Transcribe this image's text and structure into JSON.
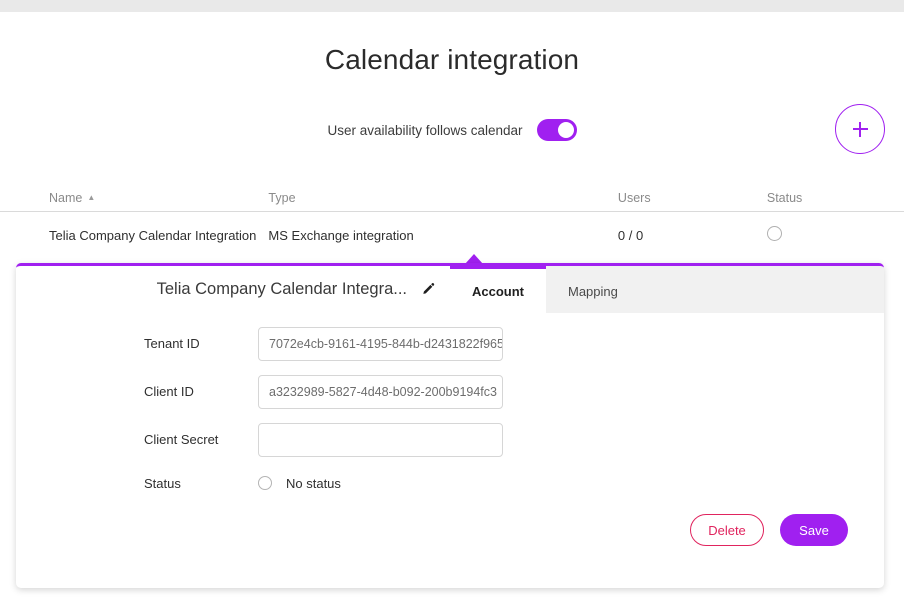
{
  "page": {
    "title": "Calendar integration"
  },
  "toggle": {
    "label": "User availability follows calendar",
    "state": "on"
  },
  "add_button": {
    "icon": "plus-icon",
    "label": "+"
  },
  "table": {
    "columns": [
      {
        "key": "name",
        "label": "Name",
        "sorted": "asc",
        "sort_caret": "▲"
      },
      {
        "key": "type",
        "label": "Type"
      },
      {
        "key": "users",
        "label": "Users"
      },
      {
        "key": "status",
        "label": "Status"
      }
    ],
    "rows": [
      {
        "name": "Telia Company Calendar Integration",
        "type": "MS Exchange integration",
        "users": "0 / 0",
        "status": "empty-circle"
      }
    ]
  },
  "panel": {
    "title": "Telia Company Calendar Integra...",
    "edit_icon": "pencil-icon",
    "accent_color": "#A020F0",
    "tabs": [
      {
        "label": "Account",
        "active": true
      },
      {
        "label": "Mapping",
        "active": false
      }
    ],
    "fields": [
      {
        "label": "Tenant ID",
        "value": "7072e4cb-9161-4195-844b-d2431822f965",
        "placeholder": ""
      },
      {
        "label": "Client ID",
        "value": "a3232989-5827-4d48-b092-200b9194fc3",
        "placeholder": ""
      },
      {
        "label": "Client Secret",
        "value": "",
        "placeholder": ""
      }
    ],
    "status": {
      "label": "Status",
      "option_label": "No status",
      "selected": false
    },
    "actions": {
      "delete_label": "Delete",
      "delete_color": "#E0245E",
      "save_label": "Save",
      "save_color": "#A020F0"
    }
  }
}
